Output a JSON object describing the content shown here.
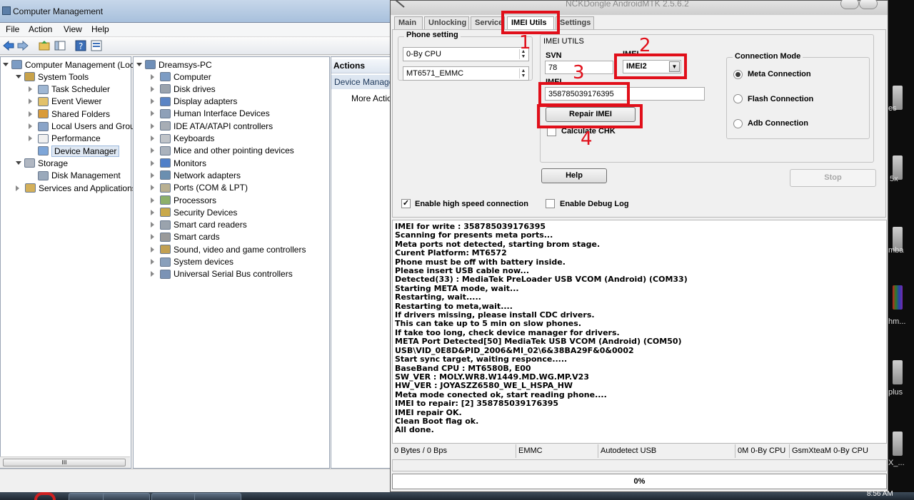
{
  "desktop": {
    "labels": [
      "es",
      "5x",
      "mba",
      "hm...",
      "plus",
      "X_..."
    ]
  },
  "computer_management": {
    "title": "Computer Management",
    "menu": [
      "File",
      "Action",
      "View",
      "Help"
    ],
    "tree_left": [
      {
        "label": "Computer Management (Local",
        "level": 0,
        "expand": "open"
      },
      {
        "label": "System Tools",
        "level": 1,
        "expand": "open"
      },
      {
        "label": "Task Scheduler",
        "level": 2,
        "expand": "closed"
      },
      {
        "label": "Event Viewer",
        "level": 2,
        "expand": "closed"
      },
      {
        "label": "Shared Folders",
        "level": 2,
        "expand": "closed"
      },
      {
        "label": "Local Users and Groups",
        "level": 2,
        "expand": "closed"
      },
      {
        "label": "Performance",
        "level": 2,
        "expand": "closed"
      },
      {
        "label": "Device Manager",
        "level": 2,
        "expand": "none",
        "selected": true
      },
      {
        "label": "Storage",
        "level": 1,
        "expand": "open"
      },
      {
        "label": "Disk Management",
        "level": 2,
        "expand": "none"
      },
      {
        "label": "Services and Applications",
        "level": 1,
        "expand": "closed"
      }
    ],
    "device_tree": {
      "root": "Dreamsys-PC",
      "items": [
        "Computer",
        "Disk drives",
        "Display adapters",
        "Human Interface Devices",
        "IDE ATA/ATAPI controllers",
        "Keyboards",
        "Mice and other pointing devices",
        "Monitors",
        "Network adapters",
        "Ports (COM & LPT)",
        "Processors",
        "Security Devices",
        "Smart card readers",
        "Smart cards",
        "Sound, video and game controllers",
        "System devices",
        "Universal Serial Bus controllers"
      ]
    },
    "actions": {
      "header": "Actions",
      "section": "Device Manager",
      "more": "More Actions"
    },
    "scroll_thumb": "III"
  },
  "nck": {
    "title": "NCKDongle AndroidMTK 2.5.6.2",
    "tabs": [
      "Main",
      "Unlocking",
      "Service",
      "IMEI Utils",
      "Settings"
    ],
    "active_tab": "IMEI Utils",
    "phone_setting": {
      "label": "Phone setting",
      "cpu": "0-By CPU",
      "platform": "MT6571_EMMC"
    },
    "imei_utils": {
      "label": "IMEI UTILS",
      "svn_label": "SVN",
      "svn_value": "78",
      "imei_select_label": "IMEI",
      "imei_select_value": "IMEI2",
      "imei_label": "IMEI",
      "imei_value": "358785039176395",
      "repair_button": "Repair IMEI",
      "calculate_chk": "Calculate CHK"
    },
    "connection_mode": {
      "label": "Connection Mode",
      "options": [
        {
          "label": "Meta Connection",
          "selected": true
        },
        {
          "label": "Flash Connection",
          "selected": false
        },
        {
          "label": "Adb Connection",
          "selected": false
        }
      ]
    },
    "help_button": "Help",
    "stop_button": "Stop",
    "enable_high_speed": {
      "label": "Enable high speed connection",
      "checked": true
    },
    "enable_debug": {
      "label": "Enable Debug Log",
      "checked": false
    },
    "annotations": [
      "1",
      "2",
      "3",
      "4"
    ],
    "annotation_color": "#e10f1a",
    "log": [
      "IMEI for write : 358785039176395",
      "Scanning for presents meta ports...",
      "Meta ports not detected, starting brom stage.",
      "Curent Platform: MT6572",
      "Phone must be off with battery inside.",
      "Please insert USB cable now...",
      "Detected(33) : MediaTek PreLoader USB VCOM (Android) (COM33)",
      "Starting META mode, wait...",
      "Restarting, wait.....",
      "Restarting to meta,wait....",
      "If drivers missing, please install CDC drivers.",
      "This can take up to 5 min on slow phones.",
      "If take too long, check device manager for drivers.",
      "META Port Detected[50] MediaTek USB VCOM (Android) (COM50)",
      "USB\\VID_0E8D&PID_2006&MI_02\\6&38BA29F&0&0002",
      "Start sync target, waiting responce.....",
      "BaseBand CPU : MT6580B, E00",
      "SW_VER : MOLY.WR8.W1449.MD.WG.MP.V23",
      "HW_VER : JOYASZZ6580_WE_L_HSPA_HW",
      "Meta mode conected ok, start reading phone....",
      "IMEI to repair: [2] 358785039176395",
      "IMEI repair OK.",
      "Clean Boot flag ok.",
      "All done."
    ],
    "status_bar": {
      "bytes": "0 Bytes / 0 Bps",
      "storage": "EMMC",
      "usb": "Autodetect USB",
      "cpu": "0M 0-By CPU",
      "dongle": "GsmXteaM 0-By CPU"
    },
    "progress": {
      "text": "0%",
      "value": 0
    }
  },
  "taskbar": {
    "clock": "8:56 AM"
  }
}
